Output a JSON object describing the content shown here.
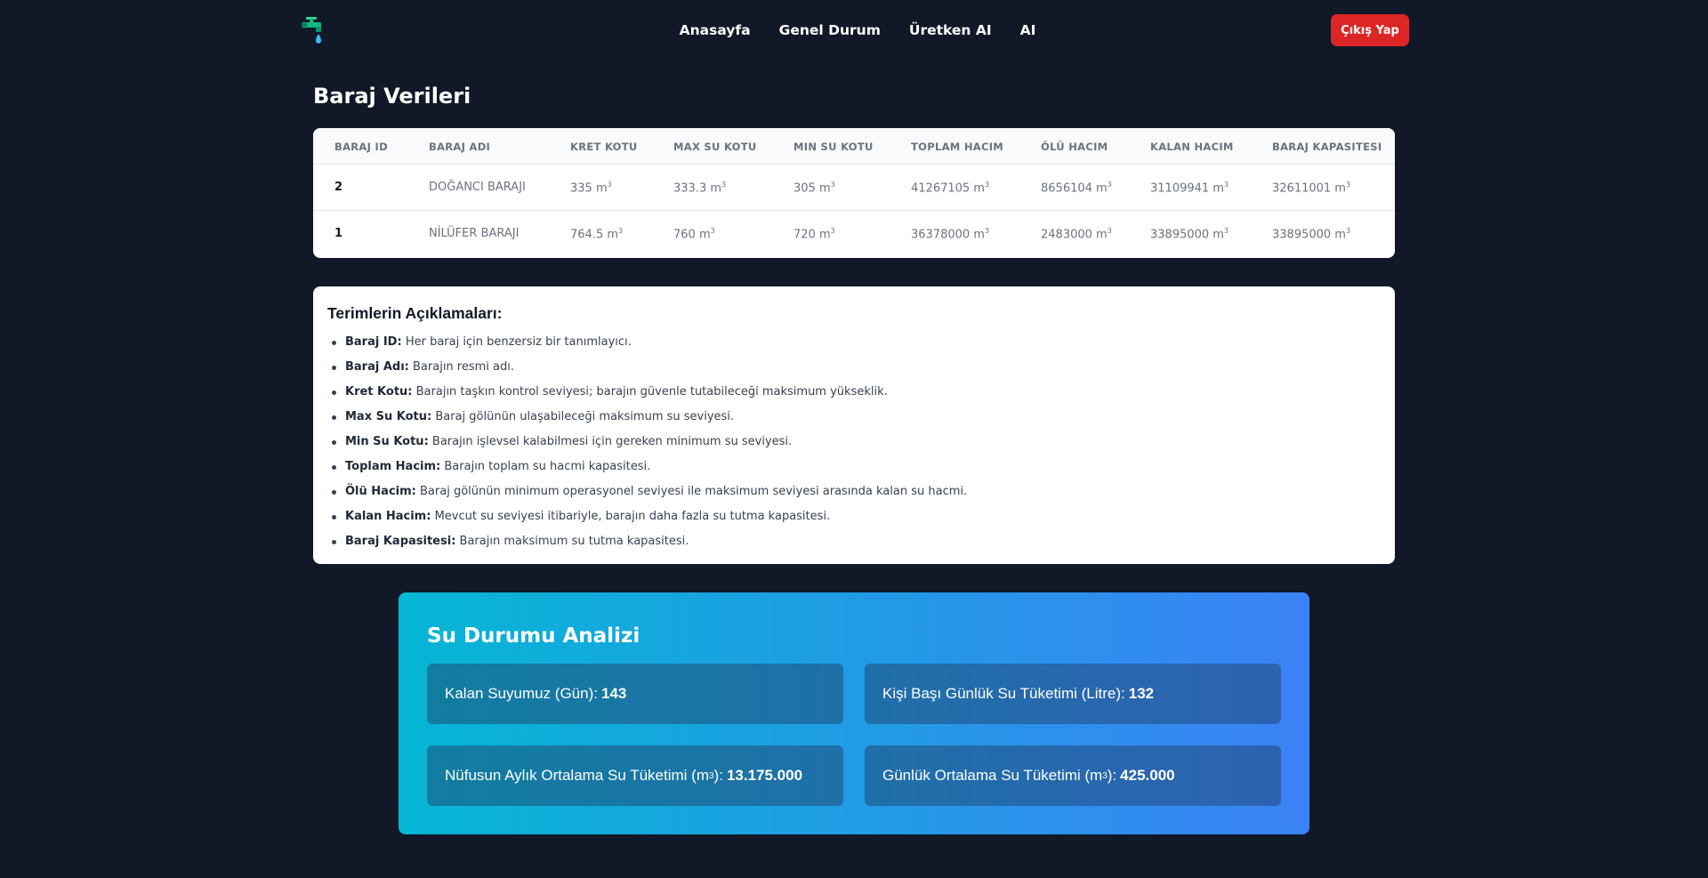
{
  "nav": {
    "links": [
      "Anasayfa",
      "Genel Durum",
      "Üretken AI",
      "AI"
    ],
    "logout": "Çıkış Yap"
  },
  "page_title": "Baraj Verileri",
  "table": {
    "headers": [
      "BARAJ ID",
      "BARAJ ADI",
      "KRET KOTU",
      "MAX SU KOTU",
      "MIN SU KOTU",
      "TOPLAM HACIM",
      "ÖLÜ HACIM",
      "KALAN HACIM",
      "BARAJ KAPASITESI"
    ],
    "unit": "m³",
    "rows": [
      [
        "2",
        "DOĞANCI BARAJI",
        "335",
        "333.3",
        "305",
        "41267105",
        "8656104",
        "31109941",
        "32611001"
      ],
      [
        "1",
        "NİLÜFER BARAJI",
        "764.5",
        "760",
        "720",
        "36378000",
        "2483000",
        "33895000",
        "33895000"
      ]
    ]
  },
  "terms": {
    "title": "Terimlerin Açıklamaları:",
    "items": [
      {
        "term": "Baraj ID:",
        "desc": "Her baraj için benzersiz bir tanımlayıcı."
      },
      {
        "term": "Baraj Adı:",
        "desc": "Barajın resmi adı."
      },
      {
        "term": "Kret Kotu:",
        "desc": "Barajın taşkın kontrol seviyesi; barajın güvenle tutabileceği maksimum yükseklik."
      },
      {
        "term": "Max Su Kotu:",
        "desc": "Baraj gölünün ulaşabileceği maksimum su seviyesi."
      },
      {
        "term": "Min Su Kotu:",
        "desc": "Barajın işlevsel kalabilmesi için gereken minimum su seviyesi."
      },
      {
        "term": "Toplam Hacim:",
        "desc": "Barajın toplam su hacmi kapasitesi."
      },
      {
        "term": "Ölü Hacim:",
        "desc": "Baraj gölünün minimum operasyonel seviyesi ile maksimum seviyesi arasında kalan su hacmi."
      },
      {
        "term": "Kalan Hacim:",
        "desc": "Mevcut su seviyesi itibariyle, barajın daha fazla su tutma kapasitesi."
      },
      {
        "term": "Baraj Kapasitesi:",
        "desc": "Barajın maksimum su tutma kapasitesi."
      }
    ]
  },
  "analysis": {
    "title": "Su Durumu Analizi",
    "stats": [
      {
        "label": "Kalan Suyumuz (Gün):",
        "value": "143"
      },
      {
        "label": "Kişi Başı Günlük Su Tüketimi (Litre):",
        "value": "132"
      },
      {
        "label": "Nüfusun Aylık Ortalama Su Tüketimi (m",
        "sup": "3",
        "label_end": "):",
        "value": "13.175.000"
      },
      {
        "label": "Günlük Ortalama Su Tüketimi (m",
        "sup": "3",
        "label_end": "):",
        "value": "425.000"
      }
    ]
  },
  "colors": {
    "background": "#111827",
    "logout": "#dc2626",
    "gradient_start": "#06b6d4",
    "gradient_end": "#3b82f6"
  },
  "icons": {
    "logo": "water-tap-icon"
  }
}
